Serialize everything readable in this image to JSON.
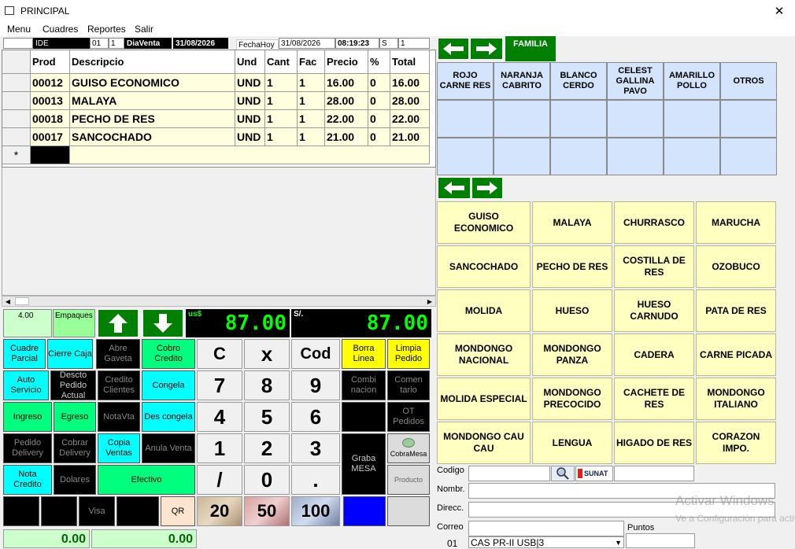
{
  "window": {
    "title": "PRINCIPAL",
    "close_glyph": "✕"
  },
  "menu": [
    "Menu",
    "Cuadres",
    "Reportes",
    "Salir"
  ],
  "header": {
    "ide_label": "IDE",
    "num1": "01",
    "num2": "1",
    "dia_venta_label": "DiaVenta",
    "dia_venta_date": "31/08/2026",
    "fecha_hoy_label": "FechaHoy",
    "fecha_hoy_date": "31/08/2026",
    "time": "08:19:23",
    "s_label": "S",
    "s_value": "1"
  },
  "grid": {
    "columns": [
      "Prod",
      "Descripcio",
      "Und",
      "Cant",
      "Fac",
      "Precio",
      "%",
      "Total"
    ],
    "rows": [
      [
        "00012",
        "GUISO ECONOMICO",
        "UND",
        "1",
        "1",
        "16.00",
        "0",
        "16.00"
      ],
      [
        "00013",
        "MALAYA",
        "UND",
        "1",
        "1",
        "28.00",
        "0",
        "28.00"
      ],
      [
        "00018",
        "PECHO DE RES",
        "UND",
        "1",
        "1",
        "22.00",
        "0",
        "22.00"
      ],
      [
        "00017",
        "SANCOCHADO",
        "UND",
        "1",
        "1",
        "21.00",
        "0",
        "21.00"
      ]
    ],
    "new_row_marker": "*"
  },
  "totals": {
    "qty": "4.00",
    "empaques_label": "Empaques",
    "usd_label": "us$",
    "usd_value": "87.00",
    "pen_label": "S/.",
    "pen_value": "87.00"
  },
  "actions": {
    "cuadre_parcial": "Cuadre Parcial",
    "cierre_caja": "Cierre Caja",
    "abre_gaveta": "Abre Gaveta",
    "cobro_credito": "Cobro Credito",
    "auto_servicio": "Auto Servicio",
    "descto_pedido": "Descto Pedido Actual",
    "credito_clientes": "Credito Clientes",
    "congela": "Congela",
    "ingreso": "Ingreso",
    "egreso": "Egreso",
    "notavta": "NotaVta",
    "descongela": "Des congela",
    "pedido_delivery": "Pedido Delivery",
    "cobrar_delivery": "Cobrar Delivery",
    "copia_ventas": "Copia Ventas",
    "anula_venta": "Anula Venta",
    "nota_credito": "Nota Credito",
    "dolares": "Dolares",
    "efectivo": "Efectivo",
    "visa": "Visa",
    "qr": "QR",
    "borra_linea": "Borra Linea",
    "limpia_pedido": "Limpia Pedido",
    "combinacion": "Combi nacion",
    "comentario": "Comen tario",
    "ot_pedidos": "OT Pedidos",
    "graba_mesa": "Graba MESA",
    "cobra_mesa": "CobraMesa",
    "producto": "Producto"
  },
  "keypad": {
    "row1": [
      "C",
      "x",
      "Cod"
    ],
    "row2": [
      "7",
      "8",
      "9"
    ],
    "row3": [
      "4",
      "5",
      "6"
    ],
    "row4": [
      "1",
      "2",
      "3"
    ],
    "row5": [
      "/",
      "0",
      "."
    ]
  },
  "bills": [
    "20",
    "50",
    "100"
  ],
  "bottom_totals": [
    "0.00",
    "0.00"
  ],
  "familia": {
    "label": "FAMILIA",
    "items": [
      "ROJO CARNE RES",
      "NARANJA CABRITO",
      "BLANCO CERDO",
      "CELEST GALLINA PAVO",
      "AMARILLO POLLO",
      "OTROS"
    ]
  },
  "products": [
    "GUISO ECONOMICO",
    "MALAYA",
    "CHURRASCO",
    "MARUCHA",
    "SANCOCHADO",
    "PECHO DE RES",
    "COSTILLA DE RES",
    "OZOBUCO",
    "MOLIDA",
    "HUESO",
    "HUESO CARNUDO",
    "PATA DE RES",
    "MONDONGO NACIONAL",
    "MONDONGO PANZA",
    "CADERA",
    "CARNE PICADA",
    "MOLIDA ESPECIAL",
    "MONDONGO PRECOCIDO",
    "CACHETE DE RES",
    "MONDONGO ITALIANO",
    "MONDONGO CAU CAU",
    "LENGUA",
    "HIGADO DE RES",
    "CORAZON IMPO."
  ],
  "client": {
    "codigo_label": "Codigo",
    "nombre_label": "Nombr.",
    "direcc_label": "Direcc.",
    "correo_label": "Correo",
    "puntos_label": "Puntos",
    "sunat_label": "SUNAT",
    "serie_num": "01",
    "serie_value": "CAS PR-II USB|3"
  },
  "watermark": {
    "line1": "Activar Windows",
    "line2": "Ve a Configuración para activar Windows."
  },
  "colors": {
    "nav_green": "#008000",
    "lcd_green": "#00ff00",
    "family_blue": "#d4e4fc",
    "product_yellow": "#ffffc0"
  }
}
